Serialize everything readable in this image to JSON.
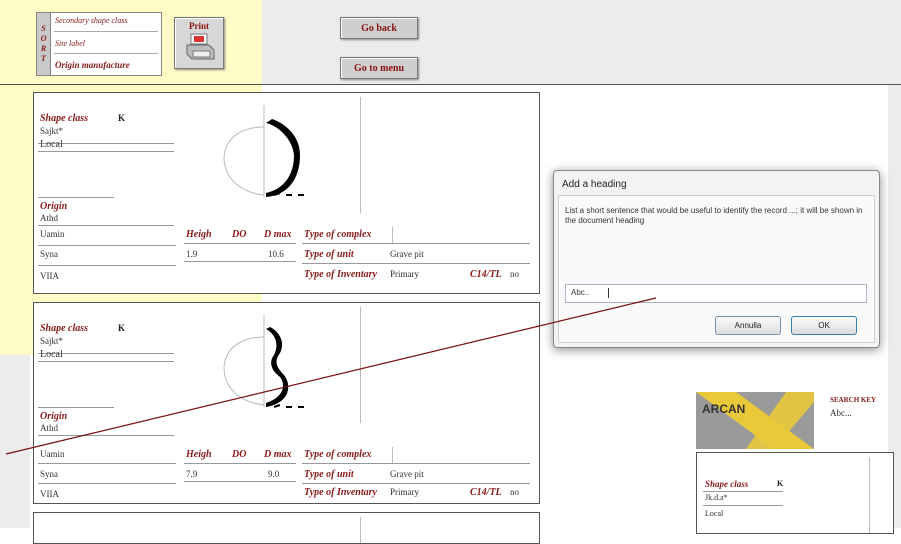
{
  "sort": {
    "letters": [
      "S",
      "O",
      "R",
      "T"
    ],
    "options": [
      "Secondary shape class",
      "Site label",
      "Origin manufacture"
    ]
  },
  "toolbar": {
    "print_label": "Print",
    "go_back_label": "Go back",
    "go_to_menu_label": "Go to menu"
  },
  "records": [
    {
      "shape_class_label": "Shape class",
      "shape_class_value": "K",
      "site_value": "Sajkt*",
      "origin_line_value": "Local",
      "origin_label": "Origin",
      "origin_value": "Athd",
      "row_left": [
        "Uamin",
        "Syna",
        "VIIA"
      ],
      "h_label": "Heigh",
      "do_label": "DO",
      "dmax_label": "D max",
      "h_value": "1.9",
      "do_value": "",
      "dmax_value": "10.6",
      "complex_label": "Type of complex",
      "complex_value": "",
      "unit_label": "Type of unit",
      "unit_value": "Grave pit",
      "deposit_label": "Type of Inventary",
      "deposit_value": "Primary",
      "chsl_label": "C14/TL",
      "chsl_value": "no"
    },
    {
      "shape_class_label": "Shape class",
      "shape_class_value": "K",
      "site_value": "Sajkt*",
      "origin_line_value": "Local",
      "origin_label": "Origin",
      "origin_value": "Athd",
      "row_left": [
        "Uamin",
        "Syna",
        "VIIA"
      ],
      "h_label": "Heigh",
      "do_label": "DO",
      "dmax_label": "D max",
      "h_value": "7.9",
      "do_value": "",
      "dmax_value": "9.0",
      "complex_label": "Type of complex",
      "complex_value": "",
      "unit_label": "Type of unit",
      "unit_value": "Grave pit",
      "deposit_label": "Type of Inventary",
      "deposit_value": "Primary",
      "chsl_label": "C14/TL",
      "chsl_value": "no"
    }
  ],
  "dialog": {
    "title": "Add a heading",
    "message": "List a short sentence that would be useful to identify the record ...; it will be shown in the document heading",
    "input_value": "Abc..",
    "cancel_label": "Annulla",
    "ok_label": "OK"
  },
  "right_panel": {
    "logo_text": "ARCAN",
    "search_key_label": "Search key",
    "search_key_value": "Abc...",
    "shape_class_label": "Shape class",
    "shape_class_value": "K",
    "site_value": "Jk.d.a*",
    "origin_line_value": "Local"
  },
  "colors": {
    "accent_red": "#8a1a1a",
    "yellow_bg": "#fdfcc4",
    "gray_bg": "#ececec",
    "logo_yellow": "#e9c93a"
  }
}
